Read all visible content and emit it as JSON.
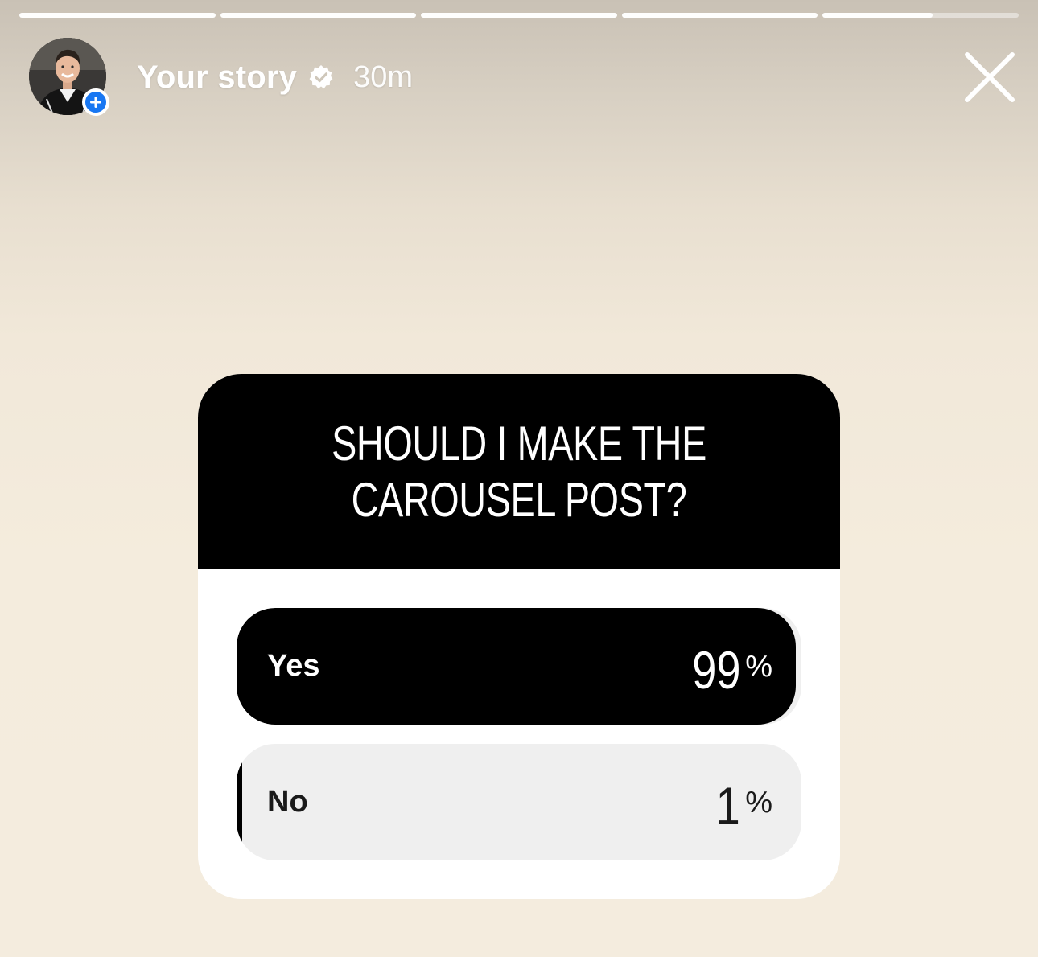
{
  "progress": {
    "segments": [
      1,
      1,
      1,
      1,
      0.56
    ]
  },
  "header": {
    "title": "Your story",
    "time": "30m",
    "verified_icon": "verified-badge-icon",
    "close_icon": "close-icon",
    "add_icon": "plus-icon"
  },
  "poll": {
    "question": "SHOULD I MAKE THE CAROUSEL POST?",
    "options": [
      {
        "label": "Yes",
        "percent": "99",
        "percent_sign": "%",
        "fraction": 0.99
      },
      {
        "label": "No",
        "percent": "1",
        "percent_sign": "%",
        "fraction": 0.01
      }
    ]
  },
  "colors": {
    "accent_blue": "#1877f2",
    "poll_dark": "#000000",
    "poll_track": "#efefef"
  }
}
